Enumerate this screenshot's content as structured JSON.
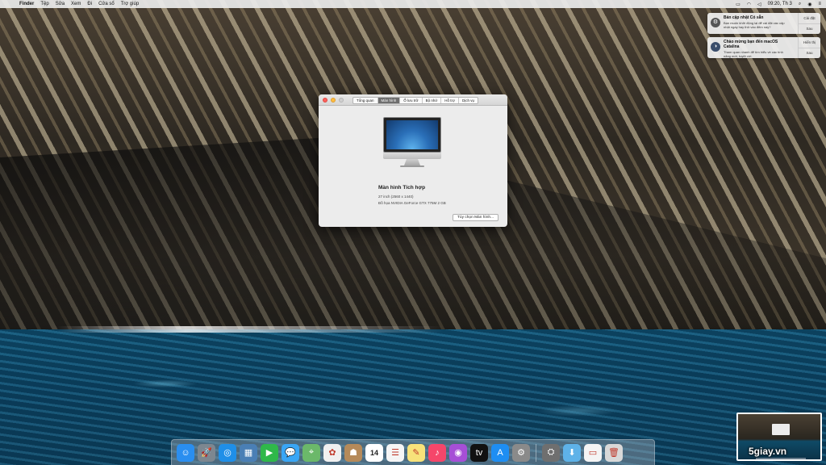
{
  "menubar": {
    "app_name": "Finder",
    "items": [
      "Tệp",
      "Sửa",
      "Xem",
      "Đi",
      "Cửa sổ",
      "Trợ giúp"
    ],
    "clock": "09:20, Th 3"
  },
  "notifications": [
    {
      "title": "Bản cập nhật Có sẵn",
      "text": "Bạn muốn khởi động lại để cài đặt các cập nhật ngay hay thử vào đêm nay?",
      "actions": [
        "Cài đặt",
        "Sau"
      ]
    },
    {
      "title": "Chào mừng bạn đến macOS Catalina",
      "text": "Tham quan nhanh để tìm hiểu về các tính năng mới, tuyệt vời.",
      "actions": [
        "Hiển thị",
        "Sau"
      ]
    }
  ],
  "about_window": {
    "tabs": [
      "Tổng quan",
      "Màn hình",
      "Ổ lưu trữ",
      "Bộ nhớ",
      "Hỗ trợ",
      "Dịch vụ"
    ],
    "active_tab_index": 1,
    "display_name": "Màn hình Tích hợp",
    "display_size": "27 inch (2560 x 1440)",
    "graphics": "Đồ họa NVIDIA GeForce GTX 775M 2 GB",
    "button_label": "Tùy chọn Màn hình..."
  },
  "dock": {
    "apps": [
      {
        "name": "finder-icon",
        "glyph": "☺",
        "color": "#2a8ef0"
      },
      {
        "name": "launchpad-icon",
        "glyph": "🚀",
        "color": "#7d8790"
      },
      {
        "name": "safari-icon",
        "glyph": "◎",
        "color": "#1f8fe8"
      },
      {
        "name": "photo-viewer-icon",
        "glyph": "▦",
        "color": "#4a7fb5"
      },
      {
        "name": "facetime-icon",
        "glyph": "▶",
        "color": "#2fb84a"
      },
      {
        "name": "messages-icon",
        "glyph": "💬",
        "color": "#39a6f5"
      },
      {
        "name": "maps-icon",
        "glyph": "⌖",
        "color": "#6bb86a"
      },
      {
        "name": "photos-icon",
        "glyph": "✿",
        "color": "#f0f0f0"
      },
      {
        "name": "contacts-icon",
        "glyph": "☗",
        "color": "#b58a5a"
      },
      {
        "name": "calendar-icon",
        "glyph": "14",
        "color": "#ffffff"
      },
      {
        "name": "reminders-icon",
        "glyph": "☰",
        "color": "#f5f5f5"
      },
      {
        "name": "notes-icon",
        "glyph": "✎",
        "color": "#f7e27a"
      },
      {
        "name": "music-icon",
        "glyph": "♪",
        "color": "#f5466a"
      },
      {
        "name": "podcasts-icon",
        "glyph": "◉",
        "color": "#a64fd6"
      },
      {
        "name": "apple-tv-icon",
        "glyph": "tv",
        "color": "#111111"
      },
      {
        "name": "app-store-icon",
        "glyph": "A",
        "color": "#1e8ef3"
      },
      {
        "name": "system-preferences-icon",
        "glyph": "⚙",
        "color": "#8a8a8a"
      }
    ],
    "others": [
      {
        "name": "utility-icon",
        "glyph": "⛭",
        "color": "#6f6f6f"
      },
      {
        "name": "downloads-folder-icon",
        "glyph": "⬇",
        "color": "#5eb2e8"
      },
      {
        "name": "document-icon",
        "glyph": "▭",
        "color": "#f4f4f4"
      },
      {
        "name": "trash-icon",
        "glyph": "🗑",
        "color": "#d8d8d8"
      }
    ]
  },
  "watermark": "5giay.vn"
}
